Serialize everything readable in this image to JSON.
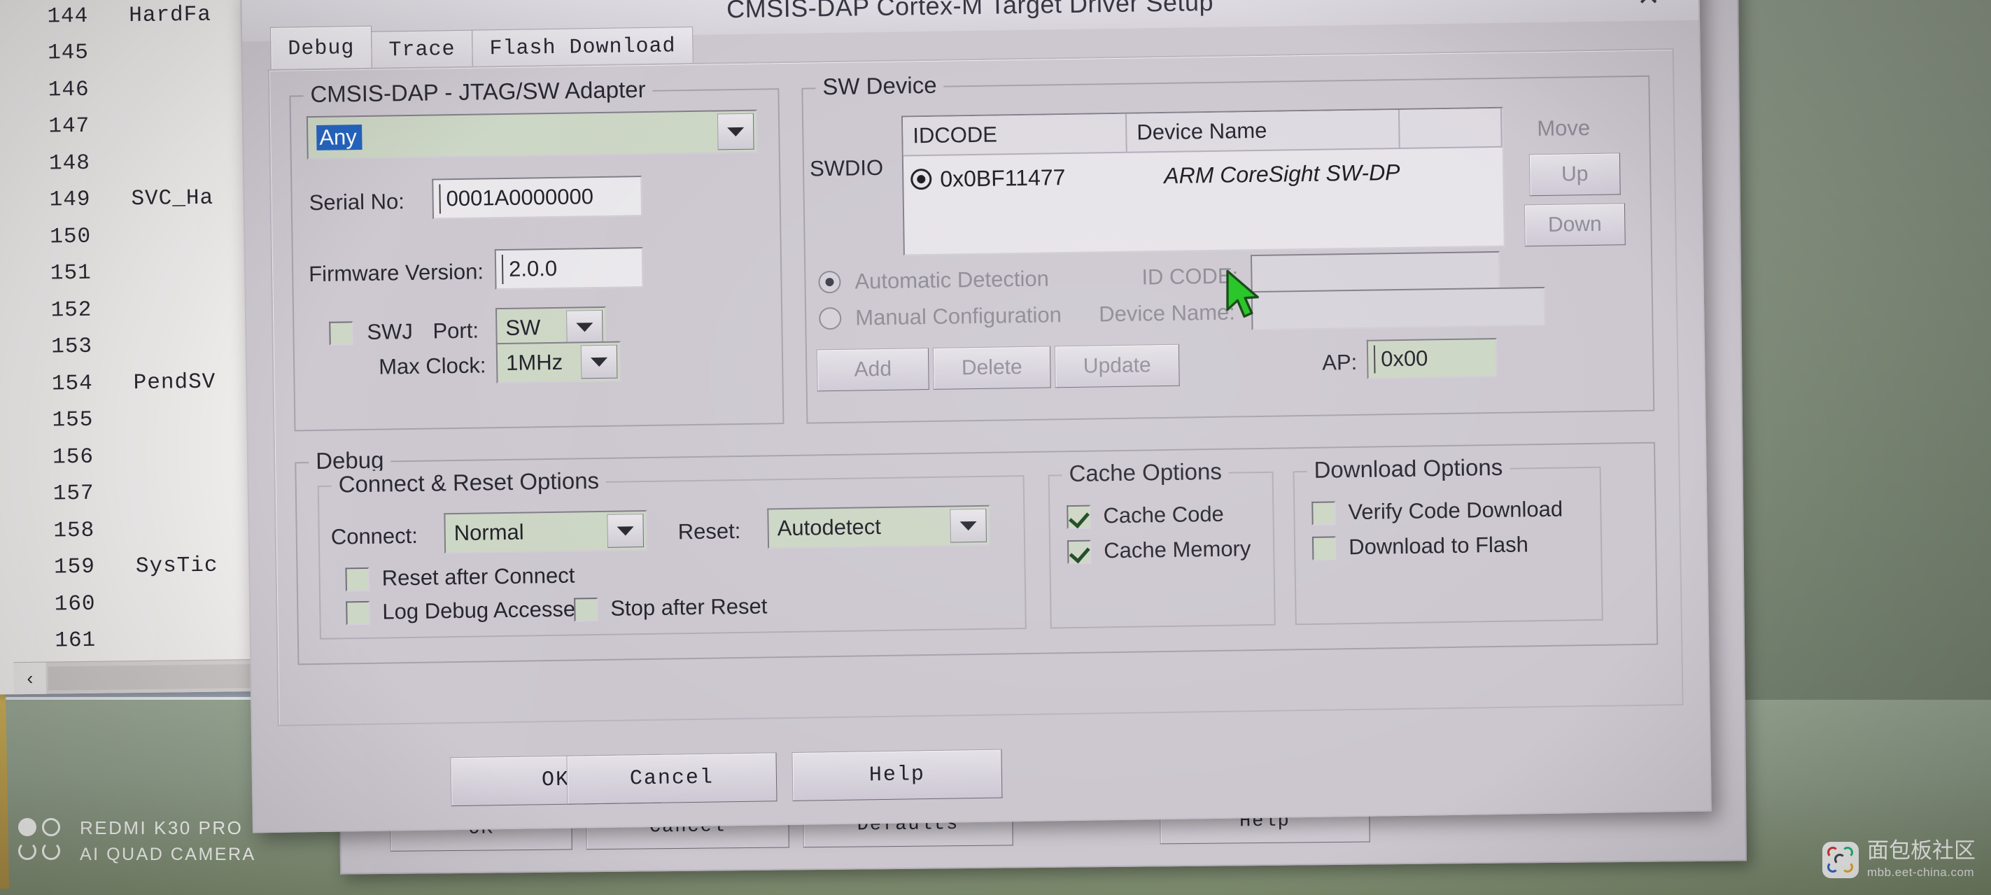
{
  "dialog": {
    "title": "CMSIS-DAP Cortex-M Target Driver Setup",
    "close_icon": "close-icon",
    "tabs": [
      {
        "label": "Debug",
        "active": true
      },
      {
        "label": "Trace",
        "active": false
      },
      {
        "label": "Flash Download",
        "active": false
      }
    ],
    "buttons": {
      "ok": "OK",
      "cancel": "Cancel",
      "help": "Help"
    }
  },
  "adapter": {
    "legend": "CMSIS-DAP - JTAG/SW Adapter",
    "selected_adapter": "Any",
    "serial_label": "Serial No:",
    "serial_value": "0001A0000000",
    "firmware_label": "Firmware Version:",
    "firmware_value": "2.0.0",
    "swj_label": "SWJ",
    "swj_checked": false,
    "port_label": "Port:",
    "port_value": "SW",
    "max_clock_label": "Max Clock:",
    "max_clock_value": "1MHz"
  },
  "sw_device": {
    "legend": "SW Device",
    "swdio_label": "SWDIO",
    "columns": [
      "IDCODE",
      "Device Name",
      ""
    ],
    "rows": [
      {
        "idcode": "0x0BF11477",
        "device_name": "ARM CoreSight SW-DP",
        "selected": true
      }
    ],
    "move_label": "Move",
    "move_up": "Up",
    "move_down": "Down",
    "automatic_detection": "Automatic Detection",
    "manual_configuration": "Manual Configuration",
    "detection_mode": "automatic",
    "id_code_label": "ID CODE:",
    "id_code_value": "",
    "device_name_label": "Device Name:",
    "device_name_value": "",
    "add": "Add",
    "delete": "Delete",
    "update": "Update",
    "ap_label": "AP:",
    "ap_value": "0x00"
  },
  "debug": {
    "legend": "Debug",
    "connect_reset": {
      "legend": "Connect & Reset Options",
      "connect_label": "Connect:",
      "connect_value": "Normal",
      "reset_label": "Reset:",
      "reset_value": "Autodetect",
      "reset_after_connect": "Reset after Connect",
      "reset_after_connect_checked": false,
      "log_debug_accesses": "Log Debug Accesses",
      "log_debug_accesses_checked": false,
      "stop_after_reset": "Stop after Reset",
      "stop_after_reset_checked": false
    },
    "cache_options": {
      "legend": "Cache Options",
      "cache_code": "Cache Code",
      "cache_code_checked": true,
      "cache_memory": "Cache Memory",
      "cache_memory_checked": true
    },
    "download_options": {
      "legend": "Download Options",
      "verify_code_download": "Verify Code Download",
      "verify_code_download_checked": false,
      "download_to_flash": "Download to Flash",
      "download_to_flash_checked": false
    }
  },
  "parent_dialog": {
    "ok": "OK",
    "cancel": "Cancel",
    "defaults": "Defaults",
    "help": "Help"
  },
  "editor": {
    "lines": [
      {
        "number": "144",
        "text": "HardFa"
      },
      {
        "number": "145",
        "text": ""
      },
      {
        "number": "146",
        "text": ""
      },
      {
        "number": "147",
        "text": ""
      },
      {
        "number": "148",
        "text": ""
      },
      {
        "number": "149",
        "text": "SVC_Ha"
      },
      {
        "number": "150",
        "text": ""
      },
      {
        "number": "151",
        "text": ""
      },
      {
        "number": "152",
        "text": ""
      },
      {
        "number": "153",
        "text": ""
      },
      {
        "number": "154",
        "text": "PendSV"
      },
      {
        "number": "155",
        "text": ""
      },
      {
        "number": "156",
        "text": ""
      },
      {
        "number": "157",
        "text": ""
      },
      {
        "number": "158",
        "text": ""
      },
      {
        "number": "159",
        "text": "SysTic"
      },
      {
        "number": "160",
        "text": ""
      },
      {
        "number": "161",
        "text": ""
      }
    ],
    "scroll_left_arrow": "‹"
  },
  "watermarks": {
    "camera_line1": "REDMI K30 PRO",
    "camera_line2": "AI QUAD CAMERA",
    "site_cn": "面包板社区",
    "site_url": "mbb.eet-china.com"
  },
  "colors": {
    "dialog_face": "#ccc7cf",
    "field_green": "#ccd6c4",
    "selection_blue": "#1c5fbe",
    "cursor_green": "#19c219",
    "desk_green": "#8d9c88"
  }
}
